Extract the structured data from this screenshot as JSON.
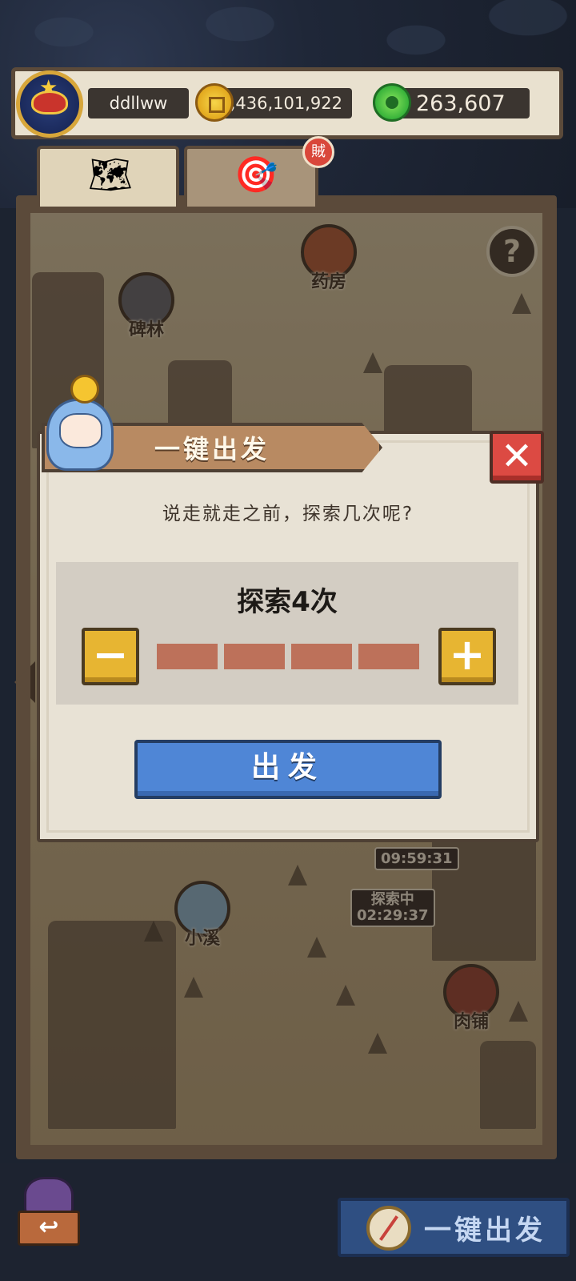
{
  "player": {
    "name": "ddllww",
    "gold": "6,436,101,922",
    "jade": "263,607"
  },
  "tabs": [
    {
      "name": "map",
      "icon": "map-icon"
    },
    {
      "name": "target",
      "icon": "target-icon",
      "badge": "賊"
    }
  ],
  "map_locations": [
    {
      "key": "pharmacy",
      "label": "药房"
    },
    {
      "key": "stele_forest",
      "label": "碑林"
    },
    {
      "key": "creek",
      "label": "小溪"
    },
    {
      "key": "butcher",
      "label": "肉铺"
    }
  ],
  "timers": [
    {
      "label": "",
      "time": "09:59:31"
    },
    {
      "label": "探索中",
      "time": "02:29:37"
    }
  ],
  "dialog": {
    "title": "一键出发",
    "question": "说走就走之前，探索几次呢?",
    "count_label": "探索4次",
    "count": 4,
    "max_count": 4,
    "go_label": "出发",
    "close_glyph": "✕",
    "minus_glyph": "−",
    "plus_glyph": "+"
  },
  "bottom": {
    "onekey_label": "一键出发",
    "back_glyph": "↩"
  },
  "colors": {
    "accent_blue": "#4f86d6",
    "segment": "#bd715a",
    "step_button": "#e7b532",
    "close_button": "#dc4a43"
  }
}
